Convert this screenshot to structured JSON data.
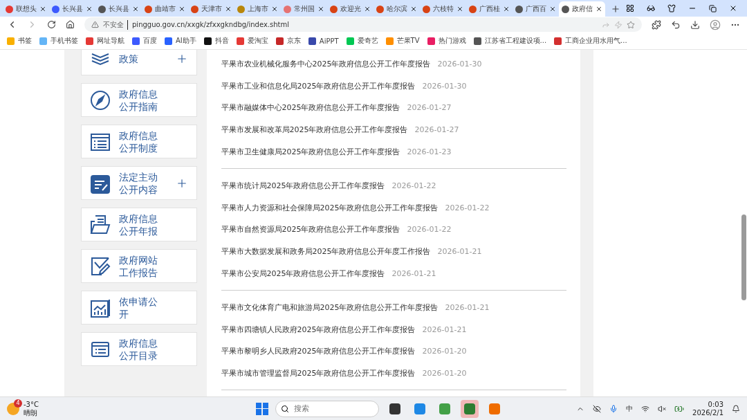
{
  "tabs": [
    {
      "title": "联想头",
      "selected": false
    },
    {
      "title": "长兴县",
      "selected": false
    },
    {
      "title": "长兴县",
      "selected": false
    },
    {
      "title": "曲靖市",
      "selected": false
    },
    {
      "title": "天津市",
      "selected": false
    },
    {
      "title": "上海市",
      "selected": false
    },
    {
      "title": "常州国",
      "selected": false
    },
    {
      "title": "欢迎光",
      "selected": false
    },
    {
      "title": "哈尔滨",
      "selected": false
    },
    {
      "title": "六枝特",
      "selected": false
    },
    {
      "title": "广西桂",
      "selected": false
    },
    {
      "title": "广西百",
      "selected": false
    },
    {
      "title": "政府信",
      "selected": true
    }
  ],
  "address": {
    "security": "不安全",
    "url": "pingguo.gov.cn/xxgk/zfxxgkndbg/index.shtml"
  },
  "bookmarks": [
    "书签",
    "手机书签",
    "网址导航",
    "百度",
    "AI助手",
    "抖音",
    "爱淘宝",
    "京东",
    "AiPPT",
    "爱奇艺",
    "芒果TV",
    "热门游戏",
    "江苏省工程建设项...",
    "工商企业用水用气..."
  ],
  "sidebar": [
    {
      "label": "政策",
      "expandable": true
    },
    {
      "label": "政府信息公开指南",
      "expandable": false
    },
    {
      "label": "政府信息公开制度",
      "expandable": false
    },
    {
      "label": "法定主动公开内容",
      "expandable": true
    },
    {
      "label": "政府信息公开年报",
      "expandable": false
    },
    {
      "label": "政府网站工作报告",
      "expandable": false
    },
    {
      "label": "依申请公开",
      "expandable": false
    },
    {
      "label": "政府信息公开目录",
      "expandable": false
    }
  ],
  "groups": [
    [
      {
        "title": "平果市农业机械化服务中心2025年政府信息公开工作年度报告",
        "date": "2026-01-30"
      },
      {
        "title": "平果市工业和信息化局2025年政府信息公开工作年度报告",
        "date": "2026-01-30"
      },
      {
        "title": "平果市融媒体中心2025年政府信息公开工作年度报告",
        "date": "2026-01-27"
      },
      {
        "title": "平果市发展和改革局2025年政府信息公开工作年度报告",
        "date": "2026-01-27"
      },
      {
        "title": "平果市卫生健康局2025年政府信息公开工作年度报告",
        "date": "2026-01-23"
      }
    ],
    [
      {
        "title": "平果市统计局2025年政府信息公开工作年度报告",
        "date": "2026-01-22"
      },
      {
        "title": "平果市人力资源和社会保障局2025年政府信息公开工作年度报告",
        "date": "2026-01-22"
      },
      {
        "title": "平果市自然资源局2025年政府信息公开工作年度报告",
        "date": "2026-01-22"
      },
      {
        "title": "平果市大数据发展和政务局2025年政府信息公开年度工作报告",
        "date": "2026-01-21"
      },
      {
        "title": "平果市公安局2025年政府信息公开工作年度报告",
        "date": "2026-01-21"
      }
    ],
    [
      {
        "title": "平果市文化体育广电和旅游局2025年政府信息公开工作年度报告",
        "date": "2026-01-21"
      },
      {
        "title": "平果市四塘镇人民政府2025年政府信息公开工作年度报告",
        "date": "2026-01-21"
      },
      {
        "title": "平果市黎明乡人民政府2025年政府信息公开工作年度报告",
        "date": "2026-01-20"
      },
      {
        "title": "平果市城市管理监督局2025年政府信息公开工作年度报告",
        "date": "2026-01-20"
      }
    ]
  ],
  "taskbar": {
    "weather_badge": "4",
    "temperature": "-3°C",
    "condition": "晴朗",
    "search_placeholder": "搜索",
    "input_method": "中",
    "time": "0:03",
    "date": "2026/2/1"
  }
}
